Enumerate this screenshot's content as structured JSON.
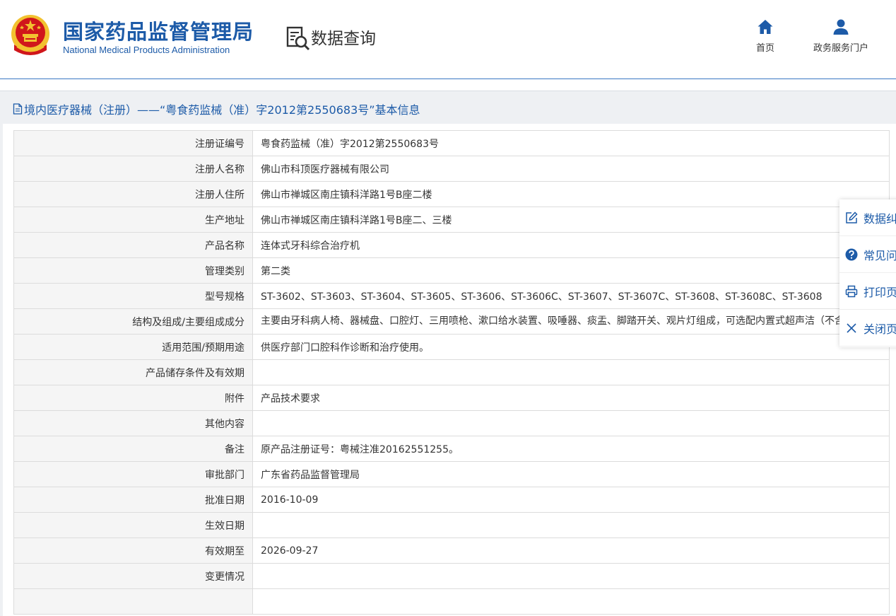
{
  "header": {
    "brand_cn": "国家药品监督管理局",
    "brand_en": "National Medical Products Administration",
    "query_title": "数据查询",
    "nav": [
      {
        "icon": "home-icon",
        "label": "首页"
      },
      {
        "icon": "user-icon",
        "label": "政务服务门户"
      }
    ]
  },
  "colors": {
    "brand": "#1d5ba8",
    "header_rule": "#3a78c3",
    "emblem_red": "#d0161b",
    "emblem_gold": "#f2c230"
  },
  "panel": {
    "title": "境内医疗器械（注册）——“粤食药监械（准）字2012第2550683号”基本信息"
  },
  "fields": [
    {
      "label": "注册证编号",
      "value": "粤食药监械（准）字2012第2550683号"
    },
    {
      "label": "注册人名称",
      "value": "佛山市科顶医疗器械有限公司"
    },
    {
      "label": "注册人住所",
      "value": "佛山市禅城区南庄镇科洋路1号B座二楼"
    },
    {
      "label": "生产地址",
      "value": "佛山市禅城区南庄镇科洋路1号B座二、三楼"
    },
    {
      "label": "产品名称",
      "value": "连体式牙科综合治疗机"
    },
    {
      "label": "管理类别",
      "value": "第二类"
    },
    {
      "label": "型号规格",
      "value": "ST-3602、ST-3603、ST-3604、ST-3605、ST-3606、ST-3606C、ST-3607、ST-3607C、ST-3608、ST-3608C、ST-3608"
    },
    {
      "label": "结构及组成/主要组成成分",
      "value": "主要由牙科病人椅、器械盘、口腔灯、三用喷枪、漱口给水装置、吸唾器、痰盂、脚踏开关、观片灯组成，可选配内置式超声洁（不含工作尖）。"
    },
    {
      "label": "适用范围/预期用途",
      "value": "供医疗部门口腔科作诊断和治疗使用。"
    },
    {
      "label": "产品储存条件及有效期",
      "value": ""
    },
    {
      "label": "附件",
      "value": "产品技术要求"
    },
    {
      "label": "其他内容",
      "value": ""
    },
    {
      "label": "备注",
      "value": "原产品注册证号：粤械注准20162551255。"
    },
    {
      "label": "审批部门",
      "value": "广东省药品监督管理局"
    },
    {
      "label": "批准日期",
      "value": "2016-10-09"
    },
    {
      "label": "生效日期",
      "value": ""
    },
    {
      "label": "有效期至",
      "value": "2026-09-27"
    },
    {
      "label": "变更情况",
      "value": ""
    },
    {
      "label": "",
      "value": ""
    }
  ],
  "side_menu": [
    {
      "icon": "edit-icon",
      "label": "数据纠错"
    },
    {
      "icon": "question-icon",
      "label": "常见问题"
    },
    {
      "icon": "print-icon",
      "label": "打印页面"
    },
    {
      "icon": "close-icon",
      "label": "关闭页面"
    }
  ]
}
